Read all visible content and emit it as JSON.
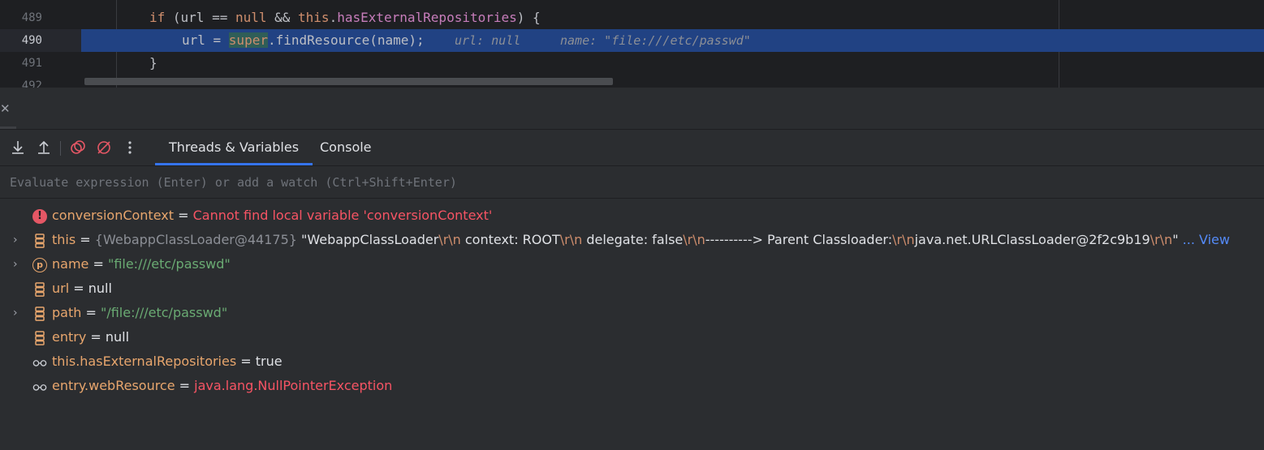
{
  "editor": {
    "lines": [
      {
        "number": "489",
        "code_if": "if",
        "code_cond_open": " (url == ",
        "code_null": "null",
        "code_and": " && ",
        "code_this": "this",
        "code_dot": ".",
        "code_field": "hasExternalRepositories",
        "code_close": ") {"
      },
      {
        "number": "490",
        "code_pre": "url = ",
        "code_super": "super",
        "code_post": ".findResource(name);",
        "hint_url": "url: null",
        "hint_name": "name: \"file:///etc/passwd\""
      },
      {
        "number": "491",
        "code": "}"
      },
      {
        "number": "492"
      }
    ]
  },
  "toolbar": {
    "icons": [
      "step-into-icon",
      "step-out-icon",
      "view-breakpoints-icon",
      "mute-breakpoints-icon",
      "more-icon"
    ],
    "tabs": [
      {
        "label": "Threads & Variables",
        "active": true
      },
      {
        "label": "Console",
        "active": false
      }
    ]
  },
  "evaluate": {
    "placeholder": "Evaluate expression (Enter) or add a watch (Ctrl+Shift+Enter)"
  },
  "variables": [
    {
      "name": "conversionContext",
      "eq": " = ",
      "value": "Cannot find local variable 'conversionContext'",
      "icon": "error-icon",
      "expandable": false
    },
    {
      "name": "this",
      "eq": " = ",
      "type": "{WebappClassLoader@44175}",
      "value_parts": [
        "\"WebappClassLoader",
        "\\r\\n",
        "  context: ROOT",
        "\\r\\n",
        "  delegate: false",
        "\\r\\n",
        "----------> Parent Classloader:",
        "\\r\\n",
        "java.net.URLClassLoader@2f2c9b19",
        "\\r\\n",
        "\""
      ],
      "link": "... View",
      "icon": "field-icon",
      "expandable": true
    },
    {
      "name": "name",
      "eq": " = ",
      "value": "\"file:///etc/passwd\"",
      "icon": "parameter-icon",
      "expandable": true
    },
    {
      "name": "url",
      "eq": " = ",
      "value": "null",
      "icon": "field-icon",
      "expandable": false
    },
    {
      "name": "path",
      "eq": " = ",
      "value": "\"/file:///etc/passwd\"",
      "icon": "field-icon",
      "expandable": true
    },
    {
      "name": "entry",
      "eq": " = ",
      "value": "null",
      "icon": "field-icon",
      "expandable": false
    },
    {
      "name": "this.hasExternalRepositories",
      "eq": " = ",
      "value": "true",
      "icon": "watch-icon",
      "expandable": false
    },
    {
      "name": "entry.webResource",
      "eq": " = ",
      "value": "java.lang.NullPointerException",
      "icon": "watch-icon",
      "expandable": false
    }
  ],
  "colors": {
    "accent": "#3574f0",
    "current_line": "#214283",
    "string": "#6aab73",
    "error": "#f75464",
    "name": "#e8a66d"
  }
}
